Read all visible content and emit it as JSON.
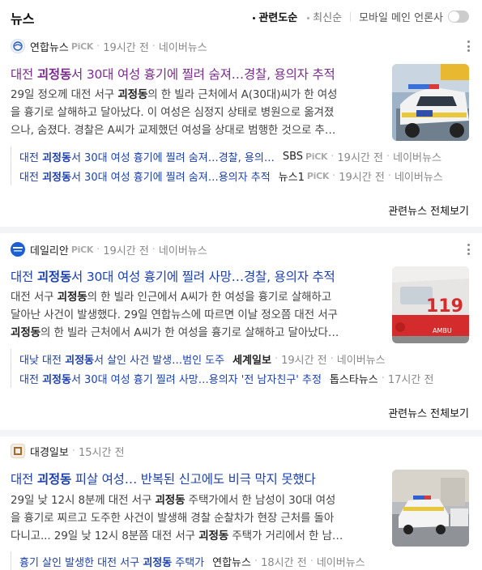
{
  "header": {
    "title": "뉴스",
    "sort_active": "관련도순",
    "sort_inactive": "최신순",
    "toggle_label": "모바일 메인 언론사"
  },
  "pick_label": "PiCK",
  "separator": "·",
  "cards": [
    {
      "press": "연합뉴스",
      "time": "19시간 전",
      "portal": "네이버뉴스",
      "headline_pre": "대전 ",
      "headline_bold": "괴정동",
      "headline_post": "서 30대 여성 흉기에 찔려 숨져…경찰, 용의자 추적",
      "summary_l1_pre": "29일 정오께 대전 서구 ",
      "summary_l1_bold": "괴정동",
      "summary_l1_post": "의 한 빌라 근처에서 A(30대)씨가 한 여성",
      "summary_l2": "을 흉기로 살해하고 달아났다. 이 여성은 심정지 상태로 병원으로 옮겨졌",
      "summary_l3": "으나, 숨졌다. 경찰은 A씨가 교제했던 여성을 상대로 범행한 것으로 추…",
      "subs": [
        {
          "pre": "대전 ",
          "bold": "괴정동",
          "post": "서 30대 여성 흉기에 찔려 숨져…경찰, 용의…",
          "press": "SBS",
          "pick": true,
          "time": "19시간 전",
          "portal": "네이버뉴스"
        },
        {
          "pre": "대전 ",
          "bold": "괴정동",
          "post": "서 30대 여성 흉기에 찔려 숨져…용의자 추적",
          "press": "뉴스1",
          "pick": true,
          "time": "19시간 전",
          "portal": "네이버뉴스"
        }
      ],
      "related": "관련뉴스 전체보기"
    },
    {
      "press": "데일리안",
      "time": "19시간 전",
      "portal": "네이버뉴스",
      "headline_pre": "대전 ",
      "headline_bold": "괴정동",
      "headline_post": "서 30대 여성 흉기에 찔려 사망…경찰, 용의자 추적",
      "summary_l1_pre": "대전 서구 ",
      "summary_l1_bold": "괴정동",
      "summary_l1_post": "의 한 빌라 인근에서 A씨가 한 여성을 흉기로 살해하고",
      "summary_l2": "달아난 사건이 발생했다. 29일 연합뉴스에 따르면 이날 정오쯤 대전 서구",
      "summary_l3_bold": "괴정동",
      "summary_l3": "의 한 빌라 근처에서 A씨가 한 여성을 흉기로 살해하고 달아났다…",
      "subs": [
        {
          "pre": "대낮 대전 ",
          "bold": "괴정동",
          "post": "서 살인 사건 발생…범인 도주",
          "press": "세계일보",
          "bold_press": true,
          "pick": false,
          "time": "19시간 전",
          "portal": "네이버뉴스"
        },
        {
          "pre": "대전 ",
          "bold": "괴정동",
          "post": "서 30대 여성 흉기 찔려 사망…용의자 '전 남자친구' 추정",
          "press": "톱스타뉴스",
          "pick": false,
          "time": "17시간 전",
          "portal": ""
        }
      ],
      "related": "관련뉴스 전체보기"
    },
    {
      "press": "대경일보",
      "time": "15시간 전",
      "headline_pre": "대전 ",
      "headline_bold": "괴정동",
      "headline_post": " 피살 여성… 반복된 신고에도 비극 막지 못했다",
      "summary_l1_pre": "29일 낮 12시 8분께 대전 서구 ",
      "summary_l1_bold": "괴정동",
      "summary_l1_post": " 주택가에서 한 남성이 30대 여성",
      "summary_l2": "을 흉기로 찌르고 도주한 사건이 발생해 경찰 순찰차가 현장 근처를 돌아",
      "summary_l3_pre": "다니고... 29일 낮 12시 8분쯤 대전 서구 ",
      "summary_l3_bold": "괴정동",
      "summary_l3": " 주택가 거리에서 한 남…",
      "subs": [
        {
          "pre": "흉기 살인 발생한 대전 서구 ",
          "bold": "괴정동",
          "post": " 주택가",
          "press": "연합뉴스",
          "pick": false,
          "time": "18시간 전",
          "portal": "네이버뉴스"
        }
      ]
    }
  ]
}
